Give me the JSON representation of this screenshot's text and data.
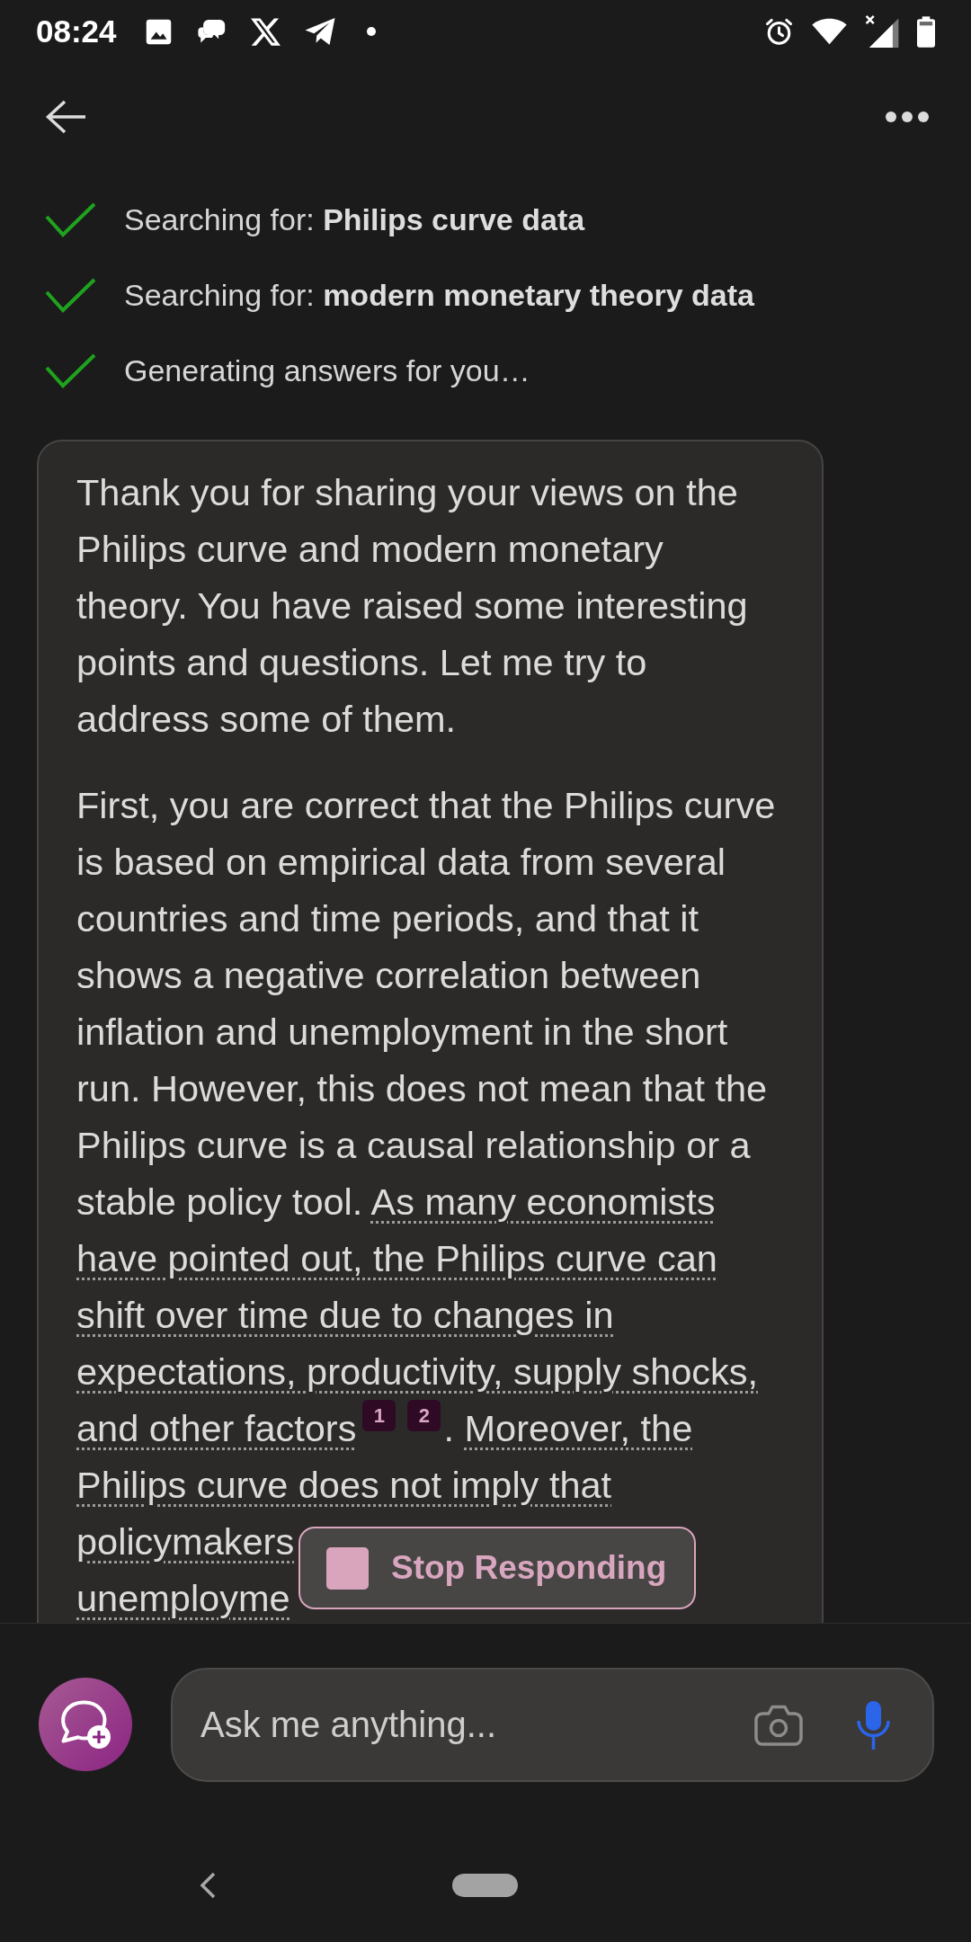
{
  "status_bar": {
    "time": "08:24"
  },
  "search_steps": [
    {
      "text": "Searching for: **Philips curve data**",
      "done": true
    },
    {
      "text": "Searching for: **modern monetary theory data**",
      "done": true
    },
    {
      "text": "Generating answers for you…",
      "done": true
    }
  ],
  "message": {
    "paragraphs": [
      {
        "segments": [
          {
            "kind": "text",
            "text": "Thank you for sharing your views on the Philips curve and modern monetary theory. You have raised some interesting points and questions. Let me try to address some of them."
          }
        ]
      },
      {
        "segments": [
          {
            "kind": "text",
            "text": "First, you are correct that the Philips curve is based on empirical data from several countries and time periods, and that it shows a negative correlation between inflation and unemployment in the short run. However, this does not mean that the Philips curve is a causal relationship or a stable policy tool. "
          },
          {
            "kind": "cited",
            "text": "As many economists have pointed out, the Philips curve can shift over time due to changes in expectations, productivity, supply shocks, and other factors"
          },
          {
            "kind": "citation",
            "text": "1"
          },
          {
            "kind": "citation",
            "text": "2"
          },
          {
            "kind": "text",
            "text": ". "
          },
          {
            "kind": "cited",
            "text": "Moreover, the Philips curve does not imply that"
          }
        ],
        "partly_covered_lines": [
          "policymakers",
          "unemployme"
        ]
      }
    ]
  },
  "stop_button": {
    "label": "Stop Responding"
  },
  "input": {
    "placeholder": "Ask me anything..."
  }
}
